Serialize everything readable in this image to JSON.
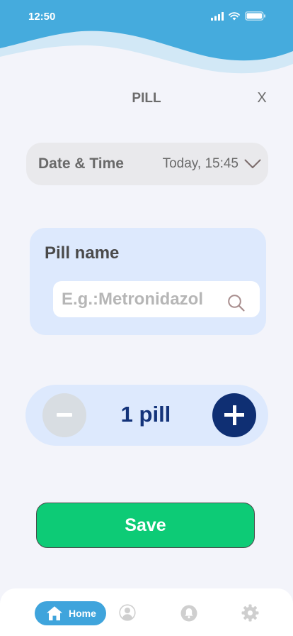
{
  "status_bar": {
    "time": "12:50",
    "icons": [
      "signal-icon",
      "wifi-icon",
      "battery-icon"
    ]
  },
  "header": {
    "title": "PILL",
    "close_label": "X"
  },
  "date_time": {
    "label": "Date & Time",
    "value": "Today, 15:45",
    "icon": "chevron-down-icon"
  },
  "pill_name": {
    "label": "Pill name",
    "placeholder": "E.g.:Metronidazol",
    "value": "",
    "icon": "search-icon"
  },
  "counter": {
    "text": "1 pill",
    "decrement_icon": "minus-icon",
    "increment_icon": "plus-icon"
  },
  "actions": {
    "save_label": "Save"
  },
  "bottom_nav": {
    "items": [
      {
        "label": "Home",
        "icon": "home-icon",
        "active": true
      },
      {
        "label": "",
        "icon": "profile-icon",
        "active": false
      },
      {
        "label": "",
        "icon": "bell-icon",
        "active": false
      },
      {
        "label": "",
        "icon": "gear-icon",
        "active": false
      }
    ]
  },
  "colors": {
    "header_blue": "#45abdd",
    "header_light_wave": "#cfe7f5",
    "background": "#f3f4fa",
    "card_blue": "#dde9fd",
    "navy": "#0f2f73",
    "save_green": "#0dcb76",
    "nav_active": "#3fa4dc",
    "nav_inactive": "#cfcfcf"
  }
}
